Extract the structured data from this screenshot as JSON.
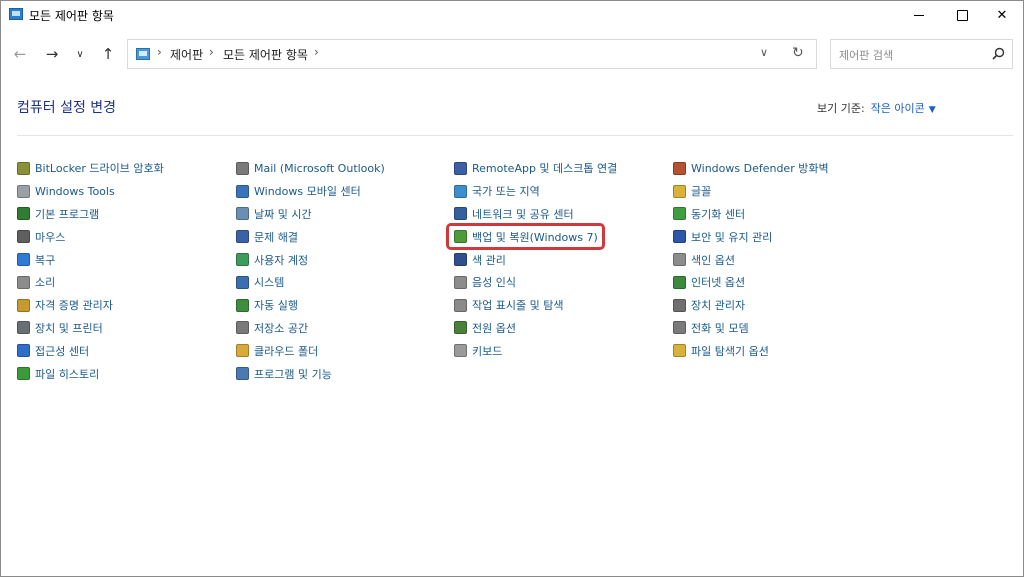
{
  "window": {
    "title": "모든 제어판 항목"
  },
  "address": {
    "crumbs": [
      "제어판",
      "모든 제어판 항목"
    ],
    "search_placeholder": "제어판 검색"
  },
  "page": {
    "title": "컴퓨터 설정 변경",
    "viewby_label": "보기 기준:",
    "viewby_value": "작은 아이콘"
  },
  "columns": [
    [
      {
        "label": "BitLocker 드라이브 암호화",
        "icon": "bitlocker-icon",
        "color": "#8a8f3a"
      },
      {
        "label": "Windows Tools",
        "icon": "windows-tools-icon",
        "color": "#9aa0a6"
      },
      {
        "label": "기본 프로그램",
        "icon": "default-programs-icon",
        "color": "#2f7d32"
      },
      {
        "label": "마우스",
        "icon": "mouse-icon",
        "color": "#5f5f5f"
      },
      {
        "label": "복구",
        "icon": "recovery-icon",
        "color": "#2e7bd6"
      },
      {
        "label": "소리",
        "icon": "sound-icon",
        "color": "#8c8c8c"
      },
      {
        "label": "자격 증명 관리자",
        "icon": "credential-manager-icon",
        "color": "#c79a2f"
      },
      {
        "label": "장치 및 프린터",
        "icon": "devices-printers-icon",
        "color": "#6a6f76"
      },
      {
        "label": "접근성 센터",
        "icon": "ease-of-access-icon",
        "color": "#2d6fc9"
      },
      {
        "label": "파일 히스토리",
        "icon": "file-history-icon",
        "color": "#3b9b3b"
      }
    ],
    [
      {
        "label": "Mail (Microsoft Outlook)",
        "icon": "mail-icon",
        "color": "#7a7a7a"
      },
      {
        "label": "Windows 모바일 센터",
        "icon": "mobility-center-icon",
        "color": "#3a74b8"
      },
      {
        "label": "날짜 및 시간",
        "icon": "date-time-icon",
        "color": "#6b8fb3"
      },
      {
        "label": "문제 해결",
        "icon": "troubleshooting-icon",
        "color": "#3a63a6"
      },
      {
        "label": "사용자 계정",
        "icon": "user-accounts-icon",
        "color": "#3f9b5a"
      },
      {
        "label": "시스템",
        "icon": "system-icon",
        "color": "#3b6fb0"
      },
      {
        "label": "자동 실행",
        "icon": "autoplay-icon",
        "color": "#3e8e3e"
      },
      {
        "label": "저장소 공간",
        "icon": "storage-spaces-icon",
        "color": "#7a7a7a"
      },
      {
        "label": "클라우드 폴더",
        "icon": "cloud-folder-icon",
        "color": "#d9a93a"
      },
      {
        "label": "프로그램 및 기능",
        "icon": "programs-features-icon",
        "color": "#4a7ab0"
      }
    ],
    [
      {
        "label": "RemoteApp 및 데스크톱 연결",
        "icon": "remoteapp-icon",
        "color": "#3c5fa8"
      },
      {
        "label": "국가 또는 지역",
        "icon": "region-icon",
        "color": "#3b8fcf"
      },
      {
        "label": "네트워크 및 공유 센터",
        "icon": "network-sharing-icon",
        "color": "#355f9e"
      },
      {
        "label": "백업 및 복원(Windows 7)",
        "icon": "backup-restore-icon",
        "color": "#4f9b3a"
      },
      {
        "label": "색 관리",
        "icon": "color-management-icon",
        "color": "#2f4f8f"
      },
      {
        "label": "음성 인식",
        "icon": "speech-recognition-icon",
        "color": "#8c8c8c"
      },
      {
        "label": "작업 표시줄 및 탐색",
        "icon": "taskbar-navigation-icon",
        "color": "#8a8a8a"
      },
      {
        "label": "전원 옵션",
        "icon": "power-options-icon",
        "color": "#4a7f3a"
      },
      {
        "label": "키보드",
        "icon": "keyboard-icon",
        "color": "#9a9a9a"
      }
    ],
    [
      {
        "label": "Windows Defender 방화벽",
        "icon": "firewall-icon",
        "color": "#b5522f"
      },
      {
        "label": "글꼴",
        "icon": "fonts-icon",
        "color": "#d8b23a"
      },
      {
        "label": "동기화 센터",
        "icon": "sync-center-icon",
        "color": "#3f9e3f"
      },
      {
        "label": "보안 및 유지 관리",
        "icon": "security-maintenance-icon",
        "color": "#2d55a8"
      },
      {
        "label": "색인 옵션",
        "icon": "indexing-options-icon",
        "color": "#8c8c8c"
      },
      {
        "label": "인터넷 옵션",
        "icon": "internet-options-icon",
        "color": "#3c8a3c"
      },
      {
        "label": "장치 관리자",
        "icon": "device-manager-icon",
        "color": "#6f6f6f"
      },
      {
        "label": "전화 및 모뎀",
        "icon": "phone-modem-icon",
        "color": "#7a7a7a"
      },
      {
        "label": "파일 탐색기 옵션",
        "icon": "file-explorer-options-icon",
        "color": "#d8b23a"
      }
    ]
  ]
}
